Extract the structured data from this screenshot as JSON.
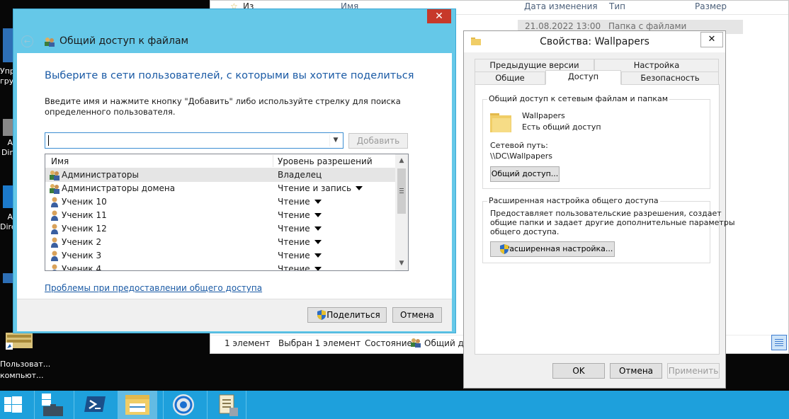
{
  "desktop": {
    "items": [
      {
        "label": "Упр",
        "sub": "гру"
      },
      {
        "label": "A",
        "sub": "Dir"
      },
      {
        "label": "A",
        "sub": "Dire"
      },
      {
        "label": "Пользоват...",
        "sub": "компьют..."
      }
    ]
  },
  "explorer": {
    "columns": {
      "name": "Имя",
      "date": "Дата изменения",
      "type": "Тип",
      "size": "Размер"
    },
    "nav_item": "Из",
    "row": {
      "date": "21.08.2022 13:00",
      "type": "Папка с файлами"
    },
    "status": {
      "count": "1 элемент",
      "selected": "Выбран 1 элемент",
      "state_label": "Состояние:",
      "state_value": "Общий до"
    }
  },
  "share_dialog": {
    "title": "Общий доступ к файлам",
    "close": "✕",
    "heading": "Выберите в сети пользователей, с которыми вы хотите поделиться",
    "hint": "Введите имя и нажмите кнопку \"Добавить\" либо используйте стрелку для поиска определенного пользователя.",
    "input_value": "",
    "add_button": "Добавить",
    "columns": {
      "name": "Имя",
      "permission": "Уровень разрешений"
    },
    "rows": [
      {
        "name": "Администраторы",
        "permission": "Владелец",
        "group": true,
        "dropdown": false
      },
      {
        "name": "Администраторы домена",
        "permission": "Чтение и запись",
        "group": true,
        "dropdown": true
      },
      {
        "name": "Ученик 10",
        "permission": "Чтение",
        "group": false,
        "dropdown": true
      },
      {
        "name": "Ученик 11",
        "permission": "Чтение",
        "group": false,
        "dropdown": true
      },
      {
        "name": "Ученик 12",
        "permission": "Чтение",
        "group": false,
        "dropdown": true
      },
      {
        "name": "Ученик 2",
        "permission": "Чтение",
        "group": false,
        "dropdown": true
      },
      {
        "name": "Ученик 3",
        "permission": "Чтение",
        "group": false,
        "dropdown": true
      },
      {
        "name": "Ученик 4",
        "permission": "Чтение",
        "group": false,
        "dropdown": true
      }
    ],
    "help_link": "Проблемы при предоставлении общего доступа",
    "share_button": "Поделиться",
    "cancel_button": "Отмена"
  },
  "properties": {
    "title": "Свойства: Wallpapers",
    "close": "✕",
    "tabs_back": [
      "Предыдущие версии",
      "Настройка"
    ],
    "tabs_front": [
      "Общие",
      "Доступ",
      "Безопасность"
    ],
    "active_tab": "Доступ",
    "network_group": {
      "title": "Общий доступ к сетевым файлам и папкам",
      "folder_name": "Wallpapers",
      "folder_state": "Есть общий доступ",
      "path_label": "Сетевой путь:",
      "path": "\\\\DC\\Wallpapers",
      "share_button": "Общий доступ..."
    },
    "advanced_group": {
      "title": "Расширенная настройка общего доступа",
      "desc_1": "Предоставляет пользовательские разрешения, создает",
      "desc_2": "общие папки и задает другие дополнительные параметры",
      "desc_3": "общего доступа.",
      "button": "Расширенная настройка..."
    },
    "ok": "OK",
    "cancel": "Отмена",
    "apply": "Применить"
  },
  "taskbar": {
    "bg": "#1ea0dc",
    "items": [
      "start-icon",
      "server-manager-icon",
      "powershell-icon",
      "file-explorer-icon",
      "chrome-icon",
      "scroll-icon"
    ]
  }
}
